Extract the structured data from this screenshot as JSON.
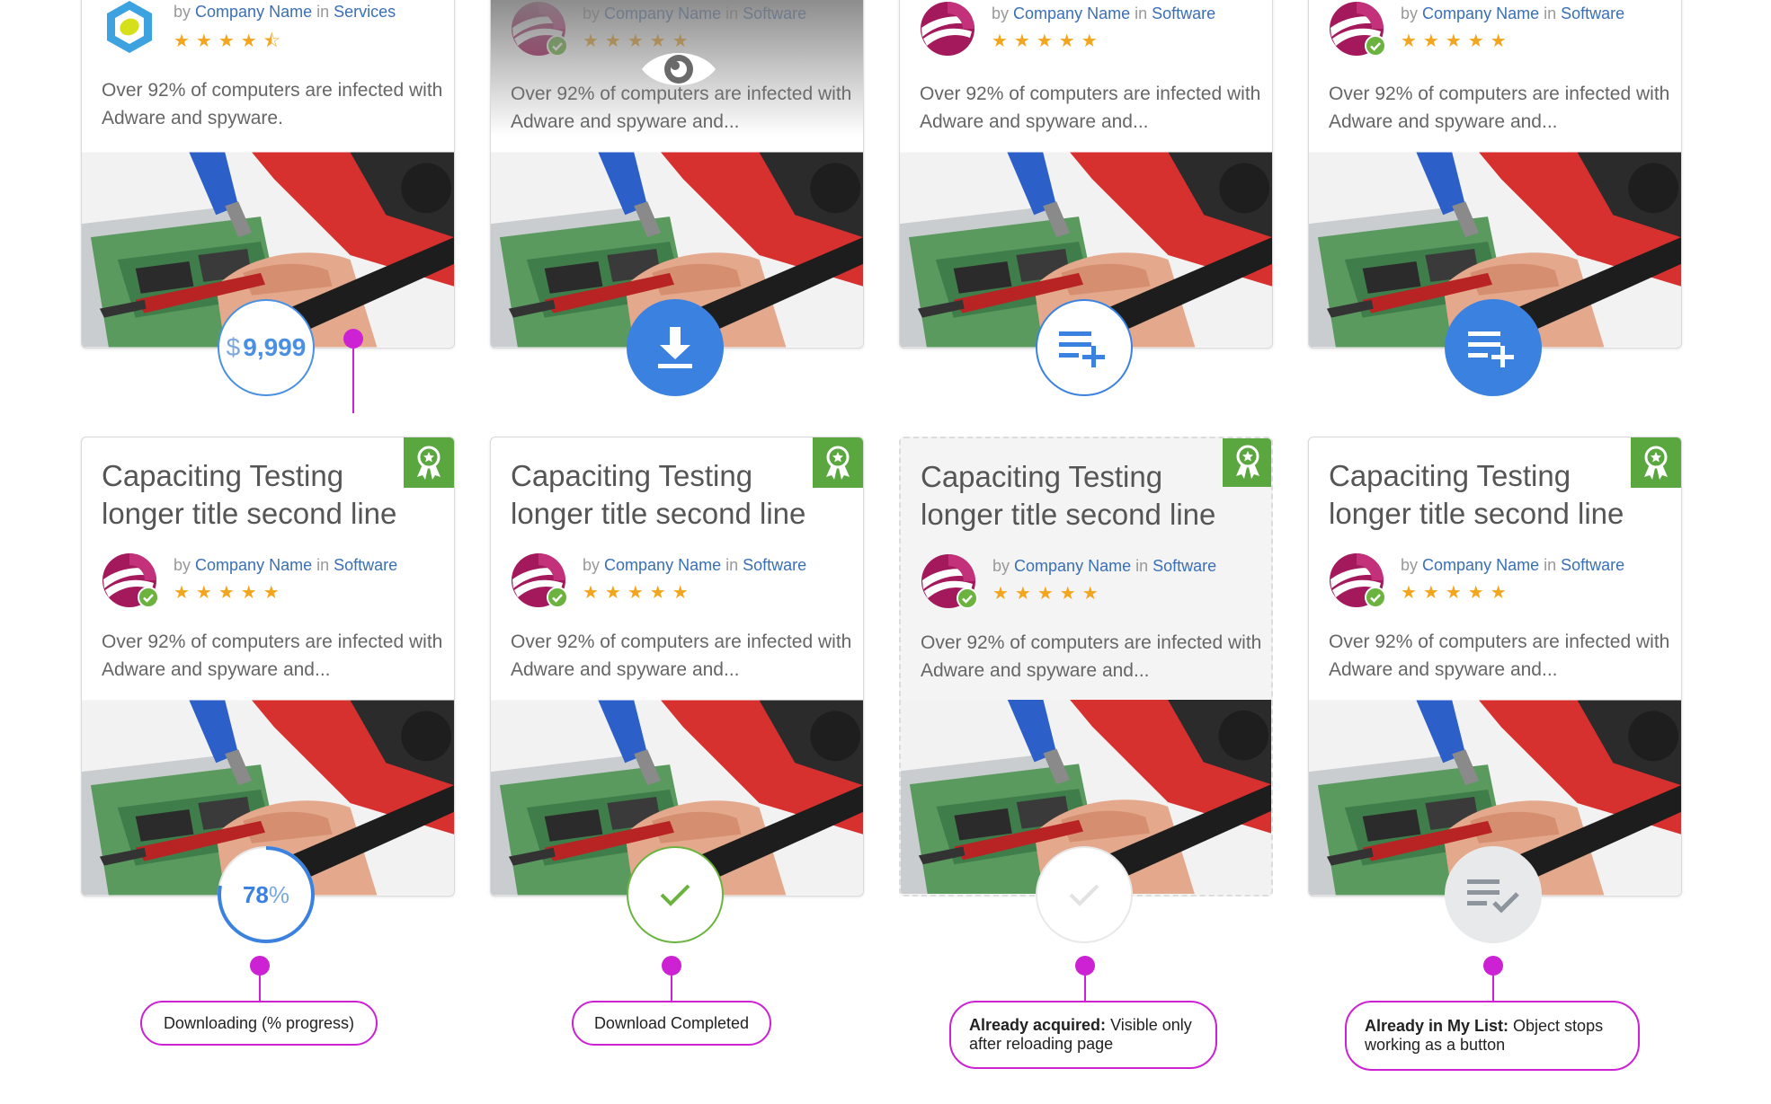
{
  "cards": {
    "services": {
      "by": "by",
      "company": "Company Name",
      "in": "in",
      "category": "Services",
      "stars": "★★★★⯪",
      "rating": 4.5,
      "desc": "Over 92% of computers are infected with Adware and spyware.",
      "price_currency": "$",
      "price_value": "9,999"
    },
    "software_top": {
      "by": "by",
      "company": "Company Name",
      "in": "in",
      "category": "Software",
      "stars": "★★★★★",
      "rating": 5,
      "desc": "Over 92% of computers are infected with Adware and spyware and..."
    },
    "software_bottom": {
      "title": "Capaciting Testing longer title second line",
      "by": "by",
      "company": "Company Name",
      "in": "in",
      "category": "Software",
      "stars": "★★★★★",
      "rating": 5,
      "desc": "Over 92% of computers are infected with Adware and spyware and..."
    }
  },
  "progress": {
    "value": "78",
    "unit": "%",
    "fraction": 0.78
  },
  "icons": {
    "top": [
      "hover-eye-icon",
      "download-icon",
      "add-to-list-icon",
      "add-to-list-icon"
    ],
    "bottom": [
      "progress-ring",
      "check-icon",
      "check-icon-faded",
      "list-check-icon"
    ],
    "badge": "award-ribbon-icon"
  },
  "notes": {
    "downloading": "Downloading (% progress)",
    "completed": "Download Completed",
    "acquired_bold": "Already acquired:",
    "acquired_rest": " Visible only after reloading page",
    "mylist_bold": "Already in My List:",
    "mylist_rest": " Object stops working as a button"
  },
  "colors": {
    "link": "#3a6fb6",
    "star": "#f3a51e",
    "badge": "#5aa63f",
    "primary": "#3b82e0",
    "success": "#6bb33e",
    "annotation": "#cc22d4"
  }
}
